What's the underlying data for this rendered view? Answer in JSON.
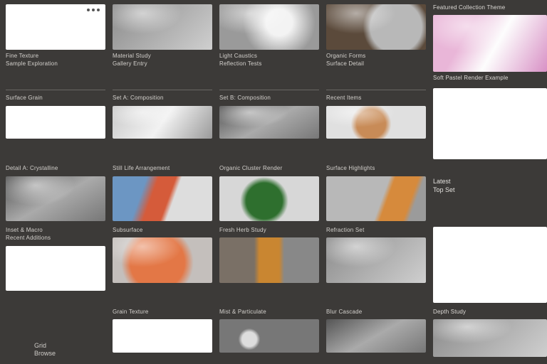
{
  "row1": {
    "c0": {
      "title": "Fine Texture",
      "sub": "Sample Exploration"
    },
    "c1": {
      "title": "Material Study",
      "sub": "Gallery Entry"
    },
    "c2": {
      "title": "Light Caustics",
      "sub": "Reflection Tests"
    },
    "c3": {
      "title": "Organic Forms",
      "sub": "Surface Detail"
    },
    "c4": {
      "title": "Featured Collection Theme"
    }
  },
  "row2": {
    "c0": {
      "title": "Surface Grain",
      "sep": true
    },
    "c1": {
      "title": "Set A: Composition"
    },
    "c2": {
      "title": "Set B: Composition"
    },
    "c3": {
      "title": "Recent Items"
    },
    "c4": {
      "title": "Soft Pastel Render Example"
    }
  },
  "row3": {
    "c0": {
      "title": "Detail A: Crystalline"
    },
    "c1": {
      "title": "Still Life Arrangement"
    },
    "c2": {
      "title": "Organic Cluster Render"
    },
    "c3": {
      "title": "Surface Highlights"
    },
    "c4": {}
  },
  "row4": {
    "c0": {
      "title": "Inset & Macro",
      "sub": "Recent Additions"
    },
    "c1": {
      "title": "Subsurface"
    },
    "c2": {
      "title": "Fresh Herb Study"
    },
    "c3": {
      "title": "Refraction Set"
    },
    "c4": {}
  },
  "row5": {
    "c0": {},
    "c1": {
      "title": "Grain Texture"
    },
    "c2": {
      "title": "Mist & Particulate"
    },
    "c3": {
      "title": "Blur Cascade"
    },
    "c4": {
      "title": "Depth Study"
    }
  },
  "side": {
    "badge1": "Latest",
    "badge2": "Top Set"
  },
  "footer": {
    "l1": "Grid",
    "l2": "Browse"
  }
}
